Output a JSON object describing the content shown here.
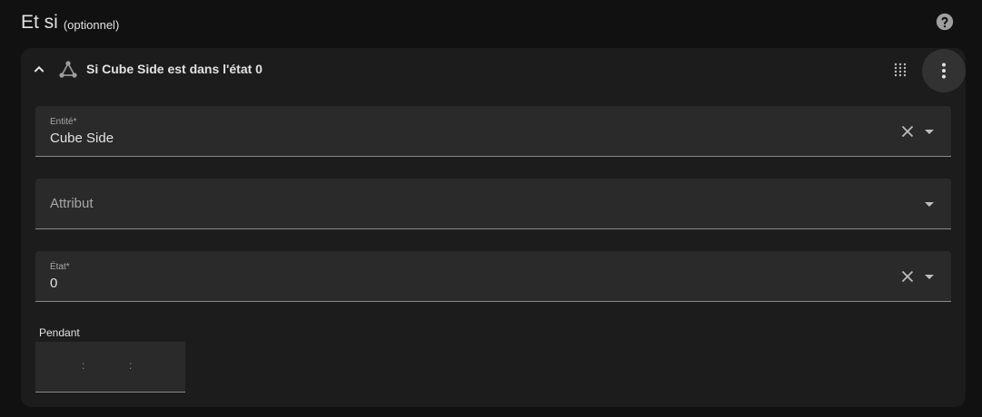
{
  "section": {
    "title": "Et si",
    "subtitle": "(optionnel)"
  },
  "icons": {
    "help": "help-circle-icon",
    "collapse": "chevron-up-icon",
    "condition": "state-condition-icon",
    "drag": "drag-handle-icon",
    "more": "dots-vertical-icon",
    "clear": "close-icon",
    "dropdown": "menu-down-icon"
  },
  "card": {
    "title": "Si Cube Side est dans l'état 0"
  },
  "fields": {
    "entity": {
      "label": "Entité*",
      "value": "Cube Side"
    },
    "attribute": {
      "placeholder": "Attribut"
    },
    "state": {
      "label": "État*",
      "value": "0"
    }
  },
  "duration": {
    "label": "Pendant",
    "separator": ":",
    "hours": "",
    "minutes": "",
    "seconds": ""
  },
  "colors": {
    "background": "#111111",
    "card": "#1c1c1c",
    "field": "#2a2a2a",
    "text": "#e1e1e1",
    "muted": "#a8a8a8"
  }
}
